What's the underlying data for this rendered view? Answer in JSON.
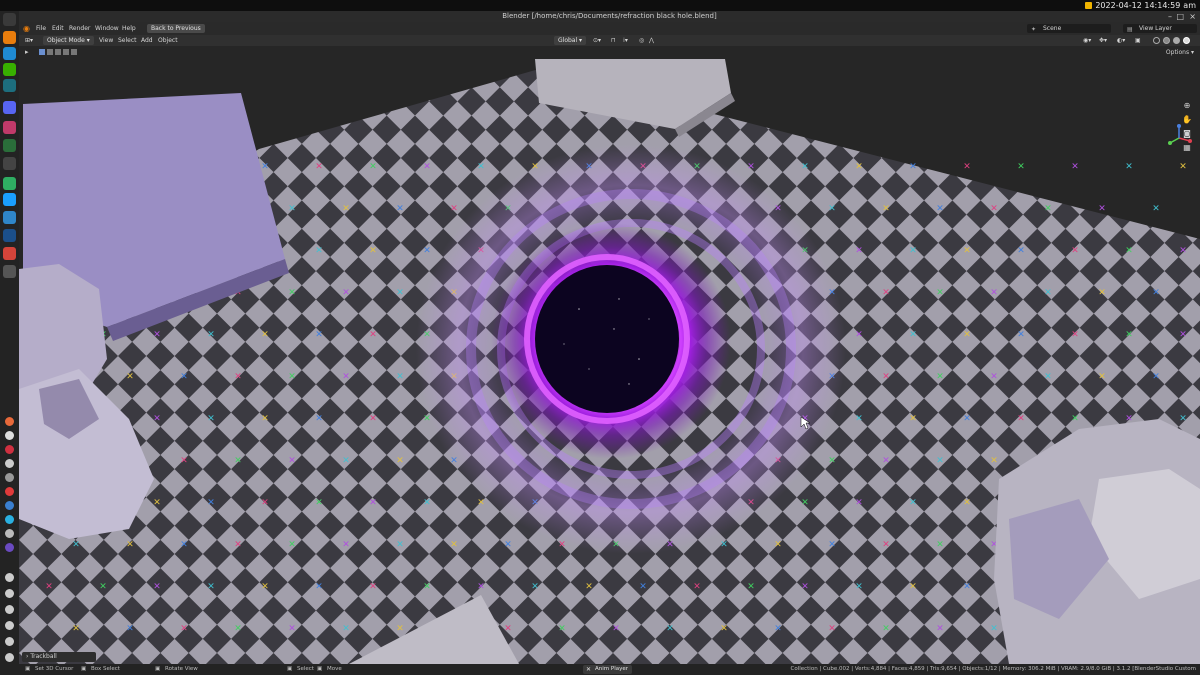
{
  "os": {
    "clock": "2022-04-12 14:14:59",
    "clock_suffix": "am"
  },
  "window": {
    "title": "Blender [/home/chris/Documents/refraction black hole.blend]"
  },
  "menu": {
    "items": [
      "File",
      "Edit",
      "Render",
      "Window",
      "Help"
    ],
    "back_button": "Back to Previous",
    "scene": "Scene",
    "view_layer": "View Layer"
  },
  "viewport_header": {
    "mode": "Object Mode",
    "items": [
      "View",
      "Select",
      "Add",
      "Object"
    ],
    "orientation": "Global"
  },
  "tool_header": {
    "options": "Options"
  },
  "operator_panel": {
    "label": "Trackball"
  },
  "statusbar": {
    "items": [
      "Set 3D Cursor",
      "Box Select",
      "Rotate View",
      "Select",
      "Move"
    ],
    "anim_player": "Anim Player",
    "stats": "Collection | Cube.002 | Verts:4,884 | Faces:4,859 | Tris:9,654 | Objects:1/12 | Memory: 306.2 MiB | VRAM: 2.9/8.0 GiB | 3.1.2 [BlenderStudio Custom"
  },
  "colors": {
    "glow": "#c020ff",
    "hole": "#0c0420",
    "checker_light": "#a9a5b2",
    "checker_dark": "#3c3b42",
    "accent": "#f0b400"
  },
  "icons": {
    "dock": [
      "app-grid-icon",
      "blender-icon",
      "vscode-icon",
      "android-icon",
      "terminal-icon",
      "discord-icon",
      "folder-icon",
      "mail-icon",
      "search-icon",
      "chart-icon",
      "steam-icon",
      "browser-icon",
      "settings-icon"
    ],
    "nav": [
      "zoom-icon",
      "pan-icon",
      "camera-icon",
      "grid-icon"
    ]
  }
}
